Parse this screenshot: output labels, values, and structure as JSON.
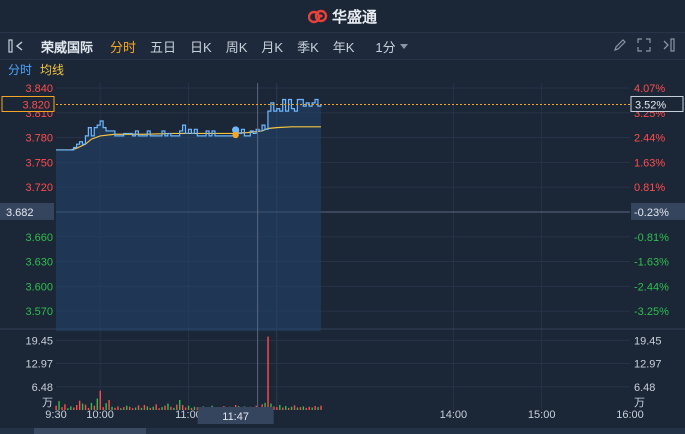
{
  "app": {
    "brand": "华盛通"
  },
  "stock": {
    "name": "荣威国际"
  },
  "tabs": [
    {
      "label": "分时",
      "active": true
    },
    {
      "label": "五日",
      "active": false
    },
    {
      "label": "日K",
      "active": false
    },
    {
      "label": "周K",
      "active": false
    },
    {
      "label": "月K",
      "active": false
    },
    {
      "label": "季K",
      "active": false
    },
    {
      "label": "年K",
      "active": false
    }
  ],
  "period": {
    "selected": "1分"
  },
  "sub": {
    "price_label": "分时",
    "avg_label": "均线"
  },
  "colors": {
    "up": "#ff4d4d",
    "down": "#2fbf4f",
    "price_line": "#6fb8ff",
    "avg_line": "#f5c542",
    "accent": "#f5a623"
  },
  "chart_data": {
    "type": "line",
    "prev_close": 3.69,
    "current_price": "3.820",
    "current_pct": "3.52%",
    "prev_close_label": "3.682",
    "prev_close_pct": "-0.23%",
    "crosshair_time": "11:47",
    "left_ticks": [
      "3.840",
      "3.810",
      "3.780",
      "3.750",
      "3.720",
      "3.690",
      "3.660",
      "3.630",
      "3.600",
      "3.570"
    ],
    "right_ticks": [
      "4.07%",
      "3.25%",
      "2.44%",
      "1.63%",
      "0.81%",
      "0.00%",
      "-0.81%",
      "-1.63%",
      "-2.44%",
      "-3.25%"
    ],
    "ylim": [
      3.546,
      3.846
    ],
    "x_ticks": [
      "9:30",
      "10:00",
      "11:00",
      "14:00",
      "15:00",
      "16:00"
    ],
    "volume_ticks": [
      "19.45",
      "12.97",
      "6.48"
    ],
    "volume_unit": "万",
    "volume_max": 21.5,
    "price_series": [
      [
        0,
        3.765
      ],
      [
        6,
        3.765
      ],
      [
        10,
        3.765
      ],
      [
        12,
        3.768
      ],
      [
        14,
        3.772
      ],
      [
        16,
        3.775
      ],
      [
        18,
        3.772
      ],
      [
        20,
        3.782
      ],
      [
        22,
        3.792
      ],
      [
        24,
        3.782
      ],
      [
        26,
        3.792
      ],
      [
        28,
        3.795
      ],
      [
        30,
        3.8
      ],
      [
        32,
        3.792
      ],
      [
        34,
        3.788
      ],
      [
        38,
        3.788
      ],
      [
        40,
        3.782
      ],
      [
        44,
        3.782
      ],
      [
        46,
        3.785
      ],
      [
        50,
        3.785
      ],
      [
        52,
        3.782
      ],
      [
        54,
        3.788
      ],
      [
        56,
        3.782
      ],
      [
        60,
        3.782
      ],
      [
        62,
        3.788
      ],
      [
        64,
        3.782
      ],
      [
        70,
        3.782
      ],
      [
        72,
        3.788
      ],
      [
        74,
        3.782
      ],
      [
        76,
        3.785
      ],
      [
        78,
        3.782
      ],
      [
        82,
        3.782
      ],
      [
        84,
        3.788
      ],
      [
        86,
        3.795
      ],
      [
        88,
        3.785
      ],
      [
        90,
        3.79
      ],
      [
        92,
        3.785
      ],
      [
        94,
        3.79
      ],
      [
        96,
        3.782
      ],
      [
        100,
        3.782
      ],
      [
        102,
        3.788
      ],
      [
        104,
        3.782
      ],
      [
        106,
        3.788
      ],
      [
        108,
        3.782
      ],
      [
        112,
        3.782
      ],
      [
        116,
        3.782
      ],
      [
        120,
        3.782
      ],
      [
        122,
        3.788
      ],
      [
        124,
        3.785
      ],
      [
        126,
        3.79
      ],
      [
        128,
        3.782
      ],
      [
        130,
        3.782
      ],
      [
        132,
        3.788
      ],
      [
        134,
        3.785
      ],
      [
        136,
        3.79
      ],
      [
        138,
        3.788
      ],
      [
        140,
        3.795
      ],
      [
        142,
        3.79
      ],
      [
        144,
        3.812
      ],
      [
        146,
        3.822
      ],
      [
        148,
        3.812
      ],
      [
        150,
        3.815
      ],
      [
        152,
        3.812
      ],
      [
        154,
        3.826
      ],
      [
        156,
        3.812
      ],
      [
        158,
        3.826
      ],
      [
        160,
        3.815
      ],
      [
        162,
        3.812
      ],
      [
        164,
        3.826
      ],
      [
        166,
        3.826
      ],
      [
        168,
        3.818
      ],
      [
        170,
        3.822
      ],
      [
        172,
        3.818
      ],
      [
        174,
        3.822
      ],
      [
        176,
        3.826
      ],
      [
        178,
        3.818
      ],
      [
        180,
        3.82
      ]
    ],
    "avg_series": [
      [
        0,
        3.765
      ],
      [
        10,
        3.765
      ],
      [
        14,
        3.767
      ],
      [
        20,
        3.772
      ],
      [
        24,
        3.778
      ],
      [
        30,
        3.782
      ],
      [
        40,
        3.784
      ],
      [
        60,
        3.784
      ],
      [
        80,
        3.785
      ],
      [
        100,
        3.785
      ],
      [
        120,
        3.785
      ],
      [
        130,
        3.786
      ],
      [
        140,
        3.788
      ],
      [
        144,
        3.791
      ],
      [
        150,
        3.792
      ],
      [
        160,
        3.793
      ],
      [
        170,
        3.793
      ],
      [
        180,
        3.793
      ]
    ],
    "volume_series": [
      [
        0,
        1.2
      ],
      [
        2,
        2.5
      ],
      [
        4,
        0.8
      ],
      [
        6,
        1.6
      ],
      [
        8,
        0.5
      ],
      [
        10,
        1.0
      ],
      [
        12,
        0.7
      ],
      [
        14,
        1.4
      ],
      [
        16,
        2.6
      ],
      [
        18,
        1.8
      ],
      [
        20,
        1.5
      ],
      [
        22,
        0.6
      ],
      [
        24,
        2.0
      ],
      [
        26,
        1.2
      ],
      [
        28,
        3.2
      ],
      [
        30,
        5.4
      ],
      [
        32,
        0.8
      ],
      [
        34,
        1.9
      ],
      [
        36,
        2.8
      ],
      [
        38,
        0.9
      ],
      [
        40,
        0.6
      ],
      [
        42,
        1.0
      ],
      [
        44,
        0.5
      ],
      [
        46,
        0.8
      ],
      [
        48,
        1.2
      ],
      [
        50,
        0.9
      ],
      [
        52,
        0.5
      ],
      [
        54,
        0.7
      ],
      [
        56,
        1.3
      ],
      [
        58,
        0.6
      ],
      [
        60,
        1.4
      ],
      [
        62,
        1.0
      ],
      [
        64,
        0.6
      ],
      [
        66,
        0.9
      ],
      [
        68,
        1.6
      ],
      [
        70,
        0.5
      ],
      [
        72,
        0.8
      ],
      [
        74,
        1.2
      ],
      [
        76,
        1.8
      ],
      [
        78,
        0.9
      ],
      [
        80,
        0.6
      ],
      [
        82,
        1.5
      ],
      [
        84,
        2.8
      ],
      [
        86,
        1.4
      ],
      [
        88,
        0.7
      ],
      [
        90,
        1.2
      ],
      [
        92,
        0.6
      ],
      [
        94,
        0.9
      ],
      [
        96,
        0.8
      ],
      [
        98,
        0.7
      ],
      [
        100,
        1.0
      ],
      [
        102,
        0.6
      ],
      [
        104,
        0.8
      ],
      [
        106,
        1.2
      ],
      [
        108,
        0.5
      ],
      [
        110,
        0.7
      ],
      [
        112,
        0.6
      ],
      [
        114,
        1.1
      ],
      [
        116,
        0.8
      ],
      [
        118,
        0.9
      ],
      [
        120,
        0.6
      ],
      [
        122,
        1.4
      ],
      [
        124,
        1.1
      ],
      [
        126,
        0.8
      ],
      [
        128,
        1.0
      ],
      [
        130,
        0.6
      ],
      [
        132,
        0.9
      ],
      [
        134,
        0.7
      ],
      [
        136,
        1.2
      ],
      [
        138,
        0.6
      ],
      [
        140,
        1.6
      ],
      [
        142,
        2.0
      ],
      [
        144,
        20.5
      ],
      [
        146,
        1.8
      ],
      [
        148,
        1.0
      ],
      [
        150,
        0.8
      ],
      [
        152,
        1.4
      ],
      [
        154,
        0.7
      ],
      [
        156,
        1.1
      ],
      [
        158,
        0.6
      ],
      [
        160,
        0.9
      ],
      [
        162,
        1.3
      ],
      [
        164,
        0.7
      ],
      [
        166,
        0.8
      ],
      [
        168,
        1.0
      ],
      [
        170,
        0.6
      ],
      [
        172,
        0.9
      ],
      [
        174,
        0.7
      ],
      [
        176,
        1.1
      ],
      [
        178,
        0.8
      ],
      [
        180,
        1.2
      ]
    ],
    "volume_up_flags": [
      1,
      0,
      1,
      1,
      0,
      0,
      1,
      1,
      1,
      0,
      1,
      1,
      0,
      1,
      0,
      1,
      1,
      0,
      1,
      0,
      1,
      1,
      0,
      1,
      0,
      1,
      1,
      0,
      1,
      0,
      1,
      0,
      1,
      0,
      1,
      1,
      0,
      1,
      0,
      1,
      0,
      1,
      0,
      1,
      1,
      0,
      1,
      0,
      1,
      0,
      0,
      1,
      1,
      0,
      1,
      0,
      1,
      1,
      0,
      1,
      0,
      1,
      0,
      1,
      0,
      1,
      1,
      0,
      1,
      0,
      1,
      0,
      1,
      0,
      1,
      1,
      0,
      1,
      0,
      1,
      0,
      1,
      0,
      1,
      0,
      1,
      1,
      0,
      1,
      0,
      1
    ]
  }
}
